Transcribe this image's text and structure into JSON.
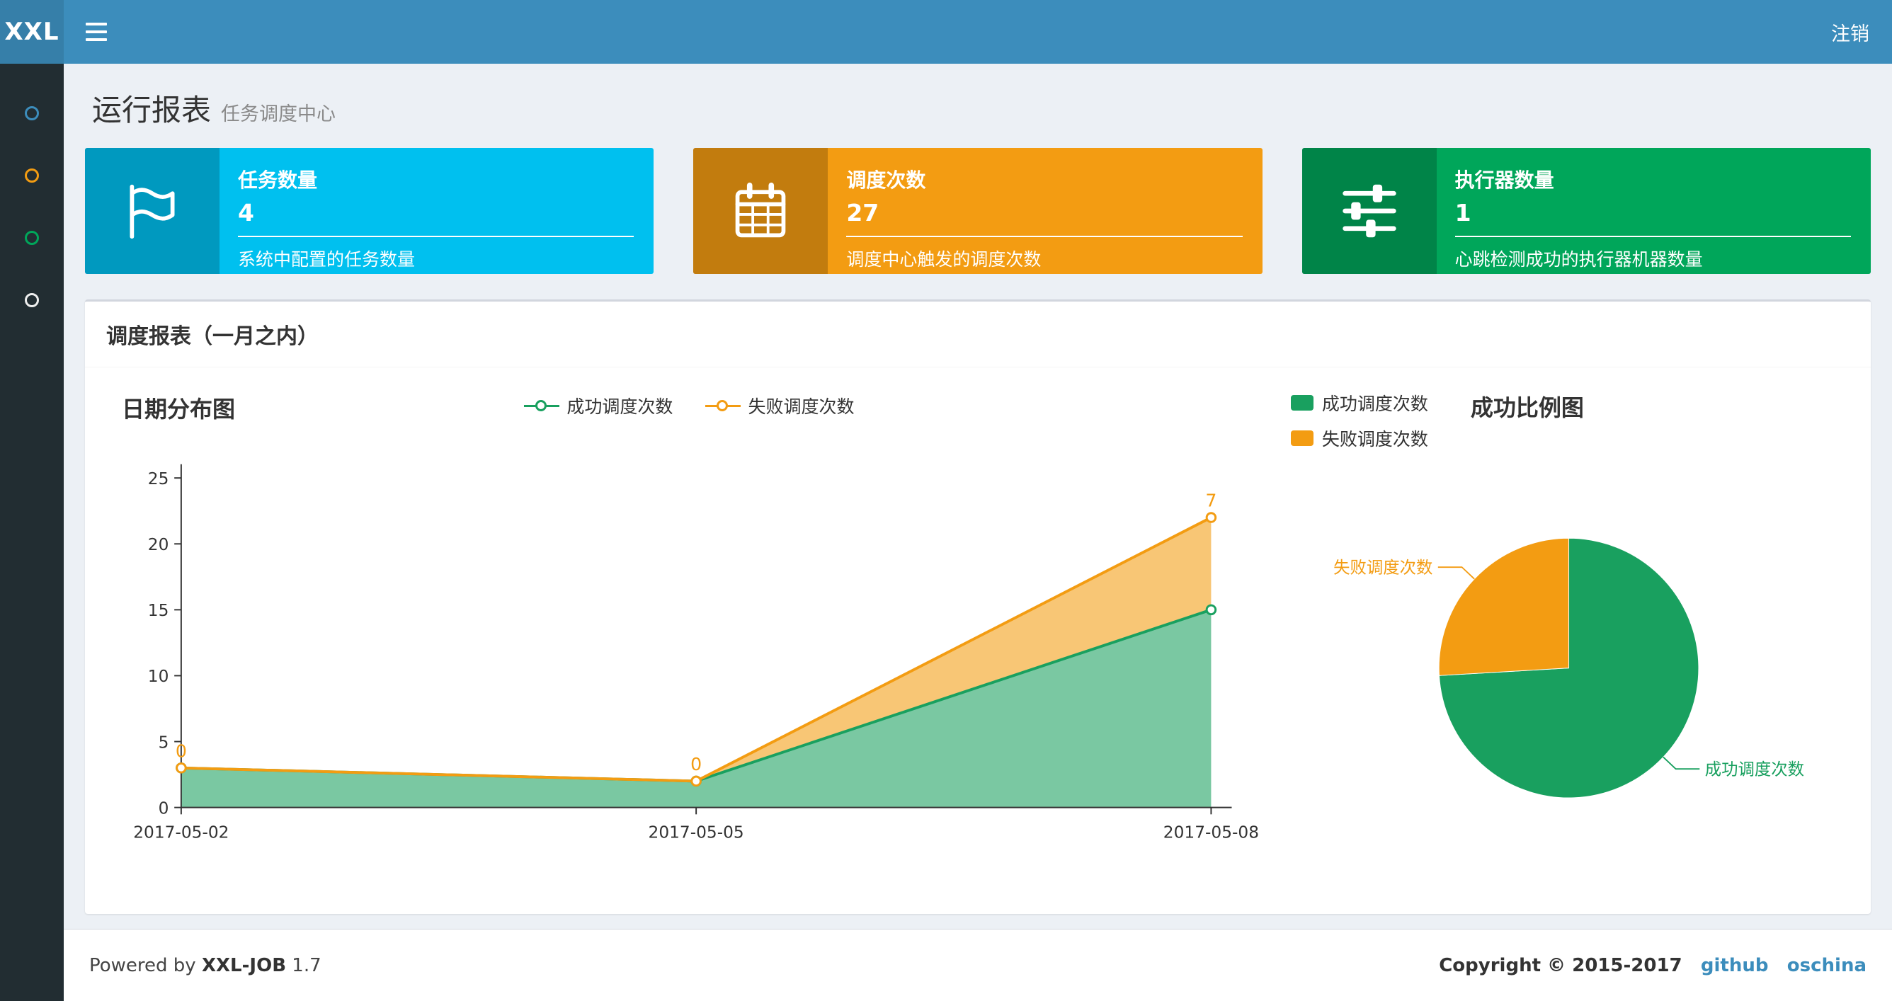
{
  "header": {
    "logo": "XXL",
    "logout_label": "注销"
  },
  "sidebar": {
    "items": [
      {
        "icon": "circle-icon",
        "color": "#3c8dbc"
      },
      {
        "icon": "circle-icon",
        "color": "#f39c12"
      },
      {
        "icon": "circle-icon",
        "color": "#00a65a"
      },
      {
        "icon": "circle-icon",
        "color": "#eeeeee"
      }
    ]
  },
  "page": {
    "title": "运行报表",
    "subtitle": "任务调度中心"
  },
  "info_boxes": [
    {
      "title": "任务数量",
      "value": "4",
      "desc": "系统中配置的任务数量",
      "color": "#00c0ef",
      "icon": "flag-icon"
    },
    {
      "title": "调度次数",
      "value": "27",
      "desc": "调度中心触发的调度次数",
      "color": "#f39c12",
      "icon": "calendar-icon"
    },
    {
      "title": "执行器数量",
      "value": "1",
      "desc": "心跳检测成功的执行器机器数量",
      "color": "#00a65a",
      "icon": "sliders-icon"
    }
  ],
  "panel": {
    "title": "调度报表（一月之内）"
  },
  "chart_data": [
    {
      "type": "area",
      "title": "日期分布图",
      "stacked": true,
      "categories": [
        "2017-05-02",
        "2017-05-05",
        "2017-05-08"
      ],
      "series": [
        {
          "name": "成功调度次数",
          "color": "#19a05f",
          "values": [
            3,
            2,
            15
          ]
        },
        {
          "name": "失败调度次数",
          "color": "#f39c12",
          "values": [
            0,
            0,
            7
          ],
          "point_labels": [
            "0",
            "0",
            "7"
          ]
        }
      ],
      "xlabel": "",
      "ylabel": "",
      "ylim": [
        0,
        25
      ],
      "yticks": [
        0,
        5,
        10,
        15,
        20,
        25
      ],
      "grid": false,
      "legend_position": "top-center"
    },
    {
      "type": "pie",
      "title": "成功比例图",
      "slices": [
        {
          "name": "成功调度次数",
          "value": 20,
          "percent": 74.1,
          "color": "#19a05f"
        },
        {
          "name": "失败调度次数",
          "value": 7,
          "percent": 25.9,
          "color": "#f39c12"
        }
      ],
      "legend_position": "top-left"
    }
  ],
  "footer": {
    "powered_prefix": "Powered by",
    "product": "XXL-JOB",
    "version": "1.7",
    "copyright": "Copyright © 2015-2017",
    "links": [
      "github",
      "oschina"
    ]
  },
  "colors": {
    "header_bg": "#3c8dbc",
    "logo_bg": "#367fa9",
    "sidebar_bg": "#222d32",
    "content_bg": "#ecf0f5",
    "link": "#3c8dbc",
    "success_green": "#19a05f",
    "fail_orange": "#f39c12",
    "info_cyan": "#00c0ef",
    "executor_green": "#00a65a"
  }
}
